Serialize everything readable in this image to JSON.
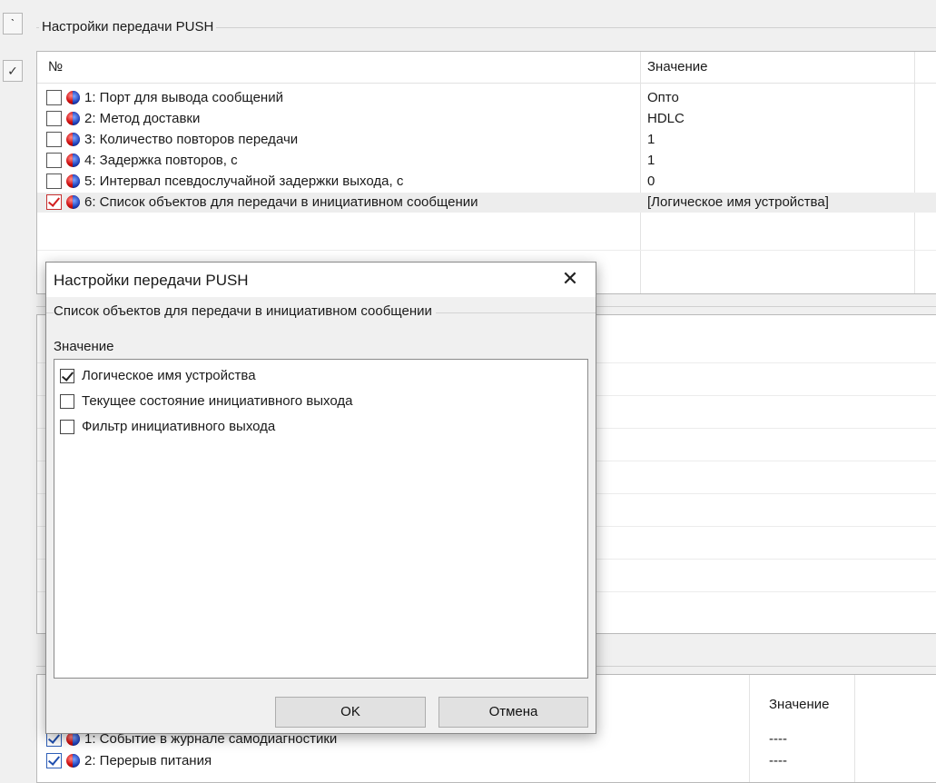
{
  "main_group": {
    "title": "Настройки передачи PUSH",
    "columns": {
      "number": "№",
      "value": "Значение"
    },
    "rows": [
      {
        "label": "1: Порт для вывода сообщений",
        "value": "Опто",
        "checked": false,
        "selected": false
      },
      {
        "label": "2: Метод доставки",
        "value": "HDLC",
        "checked": false,
        "selected": false
      },
      {
        "label": "3: Количество повторов передачи",
        "value": "1",
        "checked": false,
        "selected": false
      },
      {
        "label": "4: Задержка повторов, с",
        "value": "1",
        "checked": false,
        "selected": false
      },
      {
        "label": "5: Интервал псевдослучайной задержки выхода, с",
        "value": "0",
        "checked": false,
        "selected": false
      },
      {
        "label": "6: Список объектов для передачи в инициативном сообщении",
        "value": "[Логическое имя устройства]",
        "checked": true,
        "selected": true
      }
    ]
  },
  "dialog": {
    "title": "Настройки передачи PUSH",
    "close_glyph": "✕",
    "group_title": "Список объектов для передачи в инициативном сообщении",
    "sub_label": "Значение",
    "options": [
      {
        "label": "Логическое имя устройства",
        "checked": true
      },
      {
        "label": "Текущее состояние инициативного выхода",
        "checked": false
      },
      {
        "label": "Фильтр инициативного выхода",
        "checked": false
      }
    ],
    "ok_label": "OK",
    "cancel_label": "Отмена"
  },
  "bottom_grid": {
    "value_header": "Значение",
    "rows": [
      {
        "label": "1: Событие в журнале самодиагностики",
        "value": "----",
        "checked": true
      },
      {
        "label": "2: Перерыв питания",
        "value": "----",
        "checked": true
      }
    ]
  },
  "left_strip": {
    "top_glyph": "ˋ",
    "second_glyph": "✓"
  }
}
